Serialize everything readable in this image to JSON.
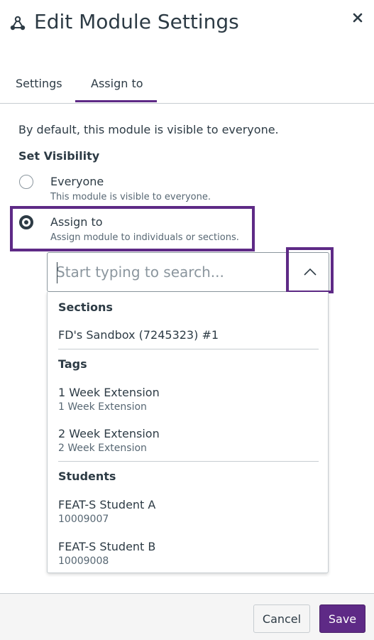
{
  "header": {
    "title": "Edit Module Settings"
  },
  "tabs": [
    {
      "label": "Settings",
      "selected": false
    },
    {
      "label": "Assign to",
      "selected": true
    }
  ],
  "assign": {
    "intro": "By default, this module is visible to everyone.",
    "set_visibility_label": "Set Visibility",
    "options": [
      {
        "label": "Everyone",
        "description": "This module is visible to everyone.",
        "checked": false
      },
      {
        "label": "Assign to",
        "description": "Assign module to individuals or sections.",
        "checked": true
      }
    ]
  },
  "search": {
    "placeholder": "Start typing to search...",
    "value": "",
    "expanded": true
  },
  "dropdown": {
    "sections_label": "Sections",
    "sections": [
      {
        "label": "FD's Sandbox (7245323) #1"
      }
    ],
    "tags_label": "Tags",
    "tags": [
      {
        "label": "1 Week Extension",
        "sub": "1 Week Extension"
      },
      {
        "label": "2 Week Extension",
        "sub": "2 Week Extension"
      }
    ],
    "students_label": "Students",
    "students": [
      {
        "label": "FEAT-S Student A",
        "sub": "10009007"
      },
      {
        "label": "FEAT-S Student B",
        "sub": "10009008"
      }
    ]
  },
  "footer": {
    "cancel_label": "Cancel",
    "save_label": "Save"
  },
  "colors": {
    "accent": "#5e2a86",
    "text": "#2d3b45",
    "muted": "#576773",
    "border": "#c7cdd1"
  },
  "icons": {
    "title": "module-icon",
    "close": "close-icon",
    "toggle": "chevron-up-icon"
  }
}
